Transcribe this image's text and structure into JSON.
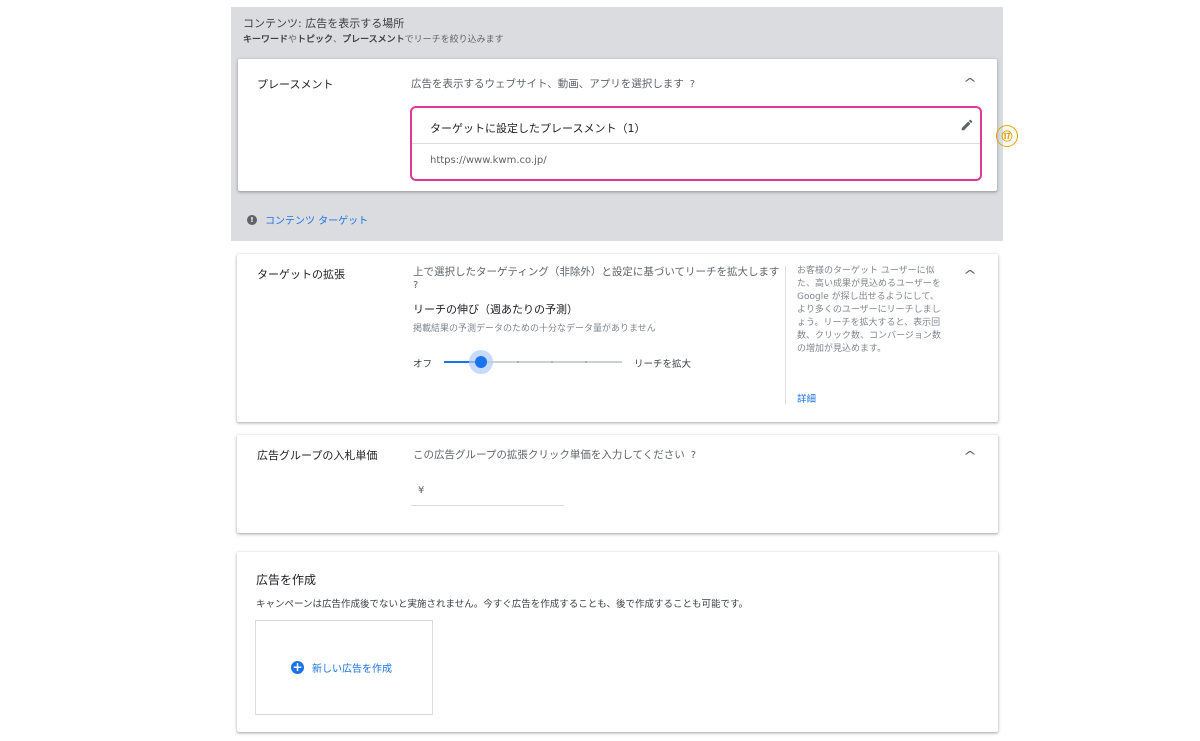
{
  "content_section": {
    "title": "コンテンツ: 広告を表示する場所",
    "subtitle_parts": [
      "キーワード",
      "や",
      "トピック",
      "、",
      "プレースメント",
      "でリーチを絞り込みます"
    ],
    "target_link": "コンテンツ ターゲット"
  },
  "placement": {
    "label": "プレースメント",
    "description": "広告を表示するウェブサイト、動画、アプリを選択します",
    "box_header": "ターゲットに設定したプレースメント（1）",
    "url": "https://www.kwm.co.jp/",
    "badge": "⑰"
  },
  "expansion": {
    "label": "ターゲットの拡張",
    "description": "上で選択したターゲティング（非除外）と設定に基づいてリーチを拡大します",
    "reach_title": "リーチの伸び（週あたりの予測）",
    "reach_note": "掲載結果の予測データのための十分なデータ量がありません",
    "slider_min_label": "オフ",
    "slider_max_label": "リーチを拡大",
    "slider_level": 0.2,
    "side_text": "お客様のターゲット ユーザーに似た、高い成果が見込めるユーザーを Google が探し出せるようにして、より多くのユーザーにリーチしましょう。リーチを拡大すると、表示回数、クリック数、コンバージョン数の増加が見込めます。",
    "detail_link": "詳細"
  },
  "bid": {
    "label": "広告グループの入札単価",
    "description": "この広告グループの拡張クリック単価を入力してください",
    "currency": "¥"
  },
  "create_ad": {
    "title": "広告を作成",
    "description": "キャンペーンは広告作成後でないと実施されません。今すぐ広告を作成することも、後で作成することも可能です。",
    "new_ad_button": "新しい広告を作成"
  },
  "colors": {
    "accent": "#1a73e8",
    "highlight_border": "#e23891",
    "badge": "#e0a100"
  }
}
